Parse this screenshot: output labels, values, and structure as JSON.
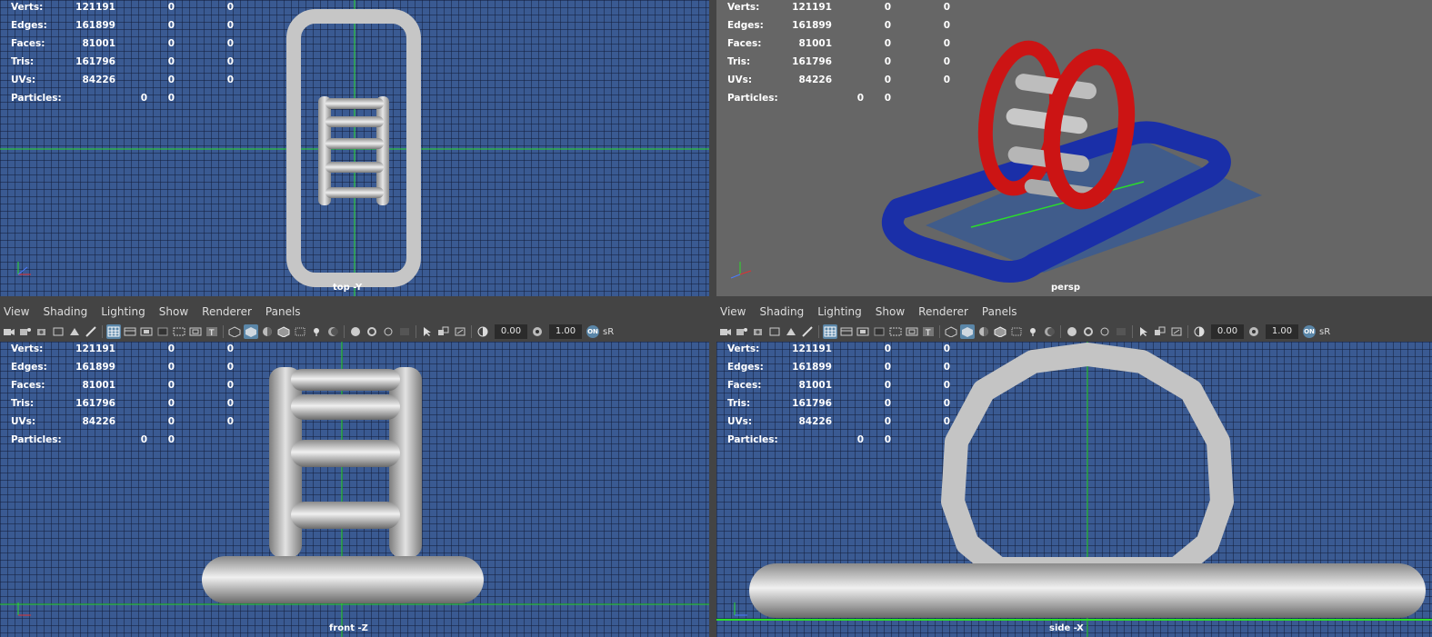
{
  "hud": [
    {
      "label": "Verts:",
      "v1": "121191",
      "v2": "0",
      "v3": "0"
    },
    {
      "label": "Edges:",
      "v1": "161899",
      "v2": "0",
      "v3": "0"
    },
    {
      "label": "Faces:",
      "v1": "81001",
      "v2": "0",
      "v3": "0"
    },
    {
      "label": "Tris:",
      "v1": "161796",
      "v2": "0",
      "v3": "0"
    },
    {
      "label": "UVs:",
      "v1": "84226",
      "v2": "0",
      "v3": "0"
    },
    {
      "label": "Particles:",
      "v1": "0",
      "v2": "0"
    }
  ],
  "viewports": {
    "top": {
      "camera": "top -Y"
    },
    "persp": {
      "camera": "persp"
    },
    "front": {
      "camera": "front -Z"
    },
    "side": {
      "camera": "side -X"
    }
  },
  "panel_menu": {
    "view": "View",
    "shading": "Shading",
    "lighting": "Lighting",
    "show": "Show",
    "renderer": "Renderer",
    "panels": "Panels"
  },
  "toolbar": {
    "exposure": "0.00",
    "gamma": "1.00",
    "on_badge": "ON",
    "color_space": "sR"
  },
  "colors": {
    "grid_bg": "#3a5a92",
    "persp_bg": "#666666",
    "axis_green": "#2bdc2b",
    "wheel_red": "#cc1414",
    "pool_blue": "#1a2fa8",
    "geo_gray": "#bdbdbd"
  }
}
